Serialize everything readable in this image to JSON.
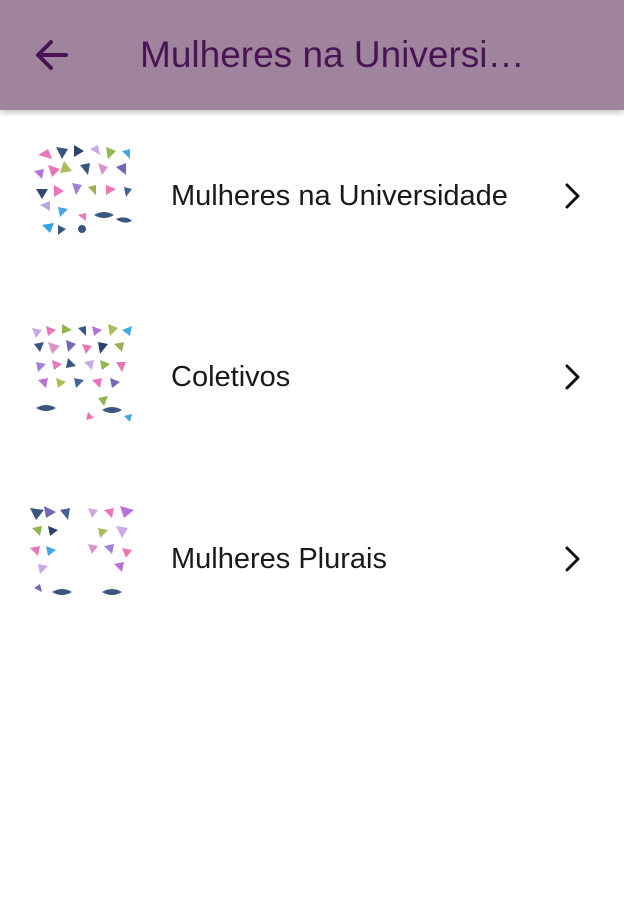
{
  "header": {
    "title": "Mulheres na Universi…",
    "background_color": "#a0849e",
    "title_color": "#4a1454",
    "back_icon": "arrow-left-icon"
  },
  "items": [
    {
      "label": "Mulheres na Universidade",
      "thumbnail_icon": "butterflies-image",
      "chevron_icon": "chevron-right-icon"
    },
    {
      "label": "Coletivos",
      "thumbnail_icon": "butterflies-image",
      "chevron_icon": "chevron-right-icon"
    },
    {
      "label": "Mulheres Plurais",
      "thumbnail_icon": "butterflies-image",
      "chevron_icon": "chevron-right-icon"
    }
  ]
}
